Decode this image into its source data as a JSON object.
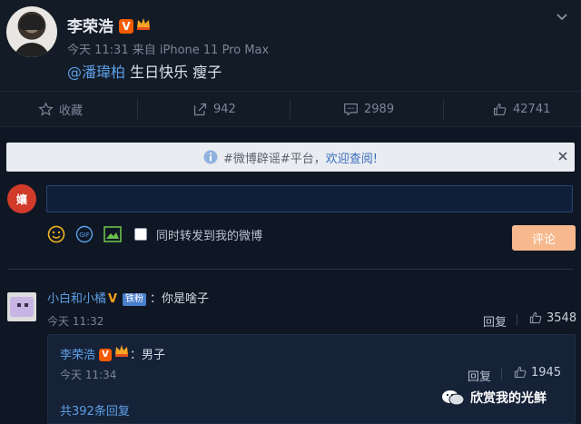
{
  "post": {
    "username": "李荣浩",
    "v_badge": "V",
    "time": "今天 11:31",
    "source": "来自 iPhone 11 Pro Max",
    "mention": "@潘瑋柏",
    "text": " 生日快乐 瘦子"
  },
  "actions": {
    "collect": "收藏",
    "repost_count": "942",
    "comment_count": "2989",
    "like_count": "42741"
  },
  "notice": {
    "text": "#微博辟谣#平台，",
    "link": "欢迎查阅!"
  },
  "composer": {
    "avatar_text": "孃",
    "input_value": "",
    "sync_label": "同时转发到我的微博",
    "submit_label": "评论",
    "gif_label": "GIF"
  },
  "comment": {
    "username": "小白和小橘",
    "v_badge": "V",
    "fan_badge": "铁粉",
    "colon": "：",
    "text": "你是啥子",
    "time": "今天 11:32",
    "reply_label": "回复",
    "like_count": "3548"
  },
  "reply": {
    "username": "李荣浩",
    "v_badge": "V",
    "colon": "：",
    "text": "男子",
    "time": "今天 11:34",
    "reply_label": "回复",
    "like_count": "1945",
    "more_replies": "共392条回复"
  },
  "watermark": {
    "text": "欣赏我的光鲜"
  },
  "colors": {
    "background": "#0f1724",
    "link": "#5d9fe6",
    "vip_orange": "#f35b00",
    "submit": "#f6b88c"
  }
}
